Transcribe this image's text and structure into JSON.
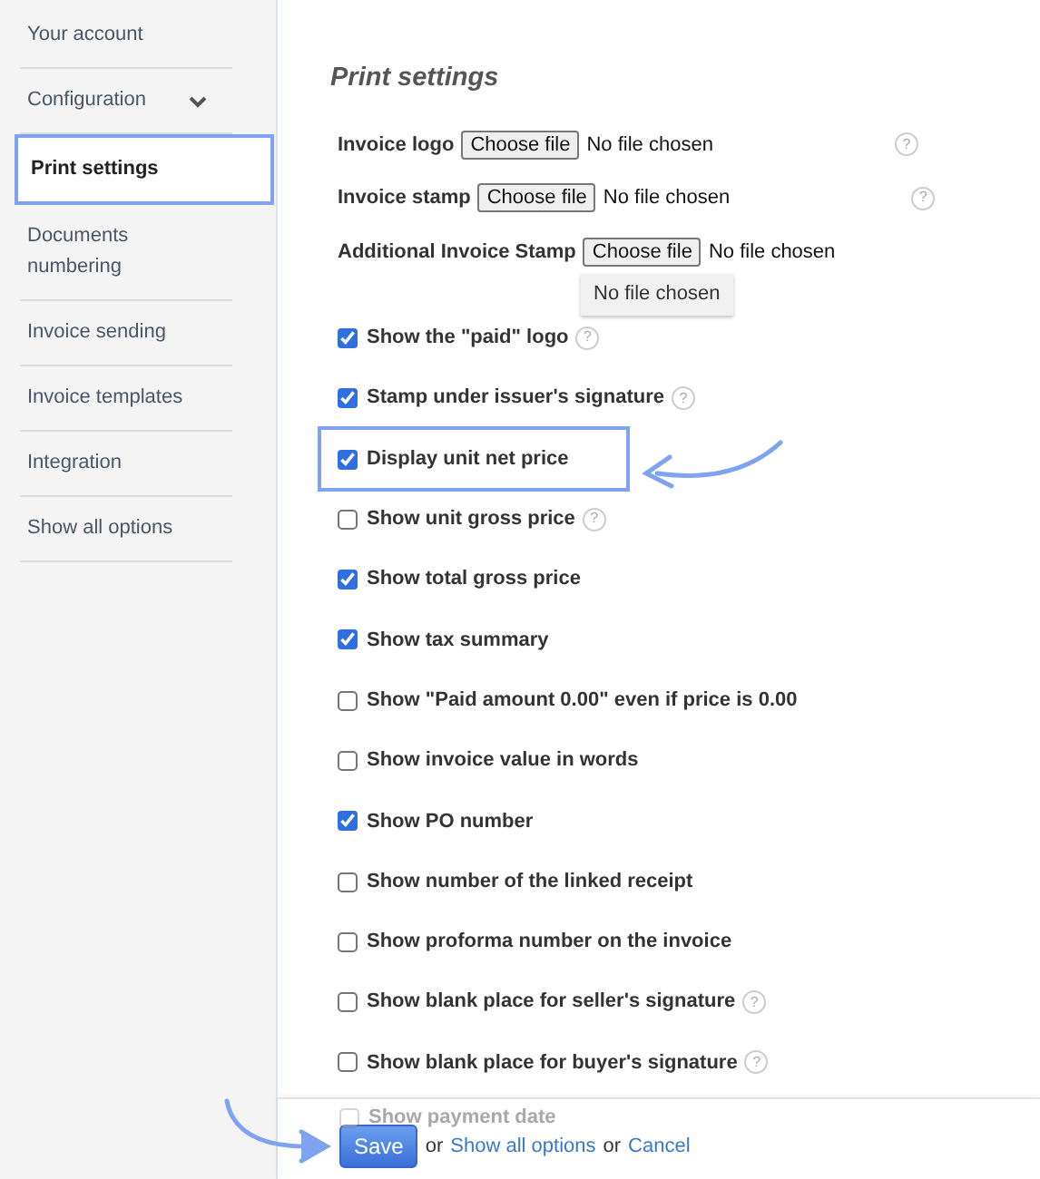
{
  "sidebar": {
    "items": [
      {
        "label": "Your account",
        "selected": false,
        "expandable": false
      },
      {
        "label": "Configuration",
        "selected": false,
        "expandable": true
      },
      {
        "label": "Print settings",
        "selected": true,
        "expandable": false
      },
      {
        "label": "Documents numbering",
        "selected": false,
        "expandable": false
      },
      {
        "label": "Invoice sending",
        "selected": false,
        "expandable": false
      },
      {
        "label": "Invoice templates",
        "selected": false,
        "expandable": false
      },
      {
        "label": "Integration",
        "selected": false,
        "expandable": false
      },
      {
        "label": "Show all options",
        "selected": false,
        "expandable": false
      }
    ]
  },
  "title": "Print settings",
  "file_inputs": [
    {
      "label": "Invoice logo",
      "button": "Choose file",
      "status": "No file chosen",
      "help": "?"
    },
    {
      "label": "Invoice stamp",
      "button": "Choose file",
      "status": "No file chosen",
      "help": "?"
    },
    {
      "label": "Additional Invoice Stamp",
      "button": "Choose file",
      "status": "No file chosen"
    }
  ],
  "tooltip": "No file chosen",
  "options": [
    {
      "label": "Show the \"paid\" logo",
      "checked": true,
      "help": "?",
      "highlighted": false
    },
    {
      "label": "Stamp under issuer's signature",
      "checked": true,
      "help": "?",
      "highlighted": false
    },
    {
      "label": "Display unit net price",
      "checked": true,
      "highlighted": true
    },
    {
      "label": "Show unit gross price",
      "checked": false,
      "help": "?",
      "highlighted": false
    },
    {
      "label": "Show total gross price",
      "checked": true,
      "highlighted": false
    },
    {
      "label": "Show tax summary",
      "checked": true,
      "highlighted": false
    },
    {
      "label": "Show \"Paid amount 0.00\" even if price is 0.00",
      "checked": false,
      "highlighted": false
    },
    {
      "label": "Show invoice value in words",
      "checked": false,
      "highlighted": false
    },
    {
      "label": "Show PO number",
      "checked": true,
      "highlighted": false
    },
    {
      "label": "Show number of the linked receipt",
      "checked": false,
      "highlighted": false
    },
    {
      "label": "Show proforma number on the invoice",
      "checked": false,
      "highlighted": false
    },
    {
      "label": "Show blank place for seller's signature",
      "checked": false,
      "help": "?",
      "highlighted": false
    },
    {
      "label": "Show blank place for buyer's signature",
      "checked": false,
      "help": "?",
      "highlighted": false
    }
  ],
  "footer": {
    "faded_option": {
      "label": "Show payment date",
      "checked": false
    },
    "save": "Save",
    "or_1": "or",
    "show_all": "Show all options",
    "or_2": "or",
    "cancel": "Cancel"
  }
}
